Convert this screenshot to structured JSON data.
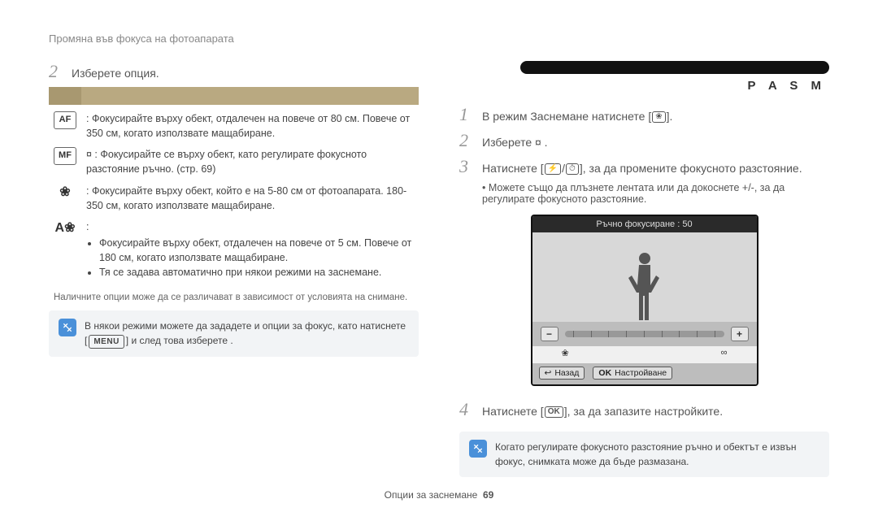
{
  "header": {
    "title": "Промяна във фокуса на фотоапарата"
  },
  "left": {
    "step2_num": "2",
    "step2_text": "Изберете опция.",
    "options": [
      {
        "icon_label": "AF",
        "name": "autofocus-icon",
        "text": ": Фокусирайте върху обект, отдалечен на повече от 80 см. Повече от 350 см, когато използвате мащабиране."
      },
      {
        "icon_label": "MF",
        "name": "manual-focus-icon",
        "text": "¤                          : Фокусирайте се върху обект, като регулирате фокусното разстояние ръчно. (стр. 69)"
      },
      {
        "icon_label": "❀",
        "name": "macro-icon",
        "text": ": Фокусирайте върху обект, който е на 5-80 см от фотоапарата. 180-350 см, когато използвате мащабиране."
      },
      {
        "icon_label": "A❀",
        "name": "auto-macro-icon",
        "text": ":",
        "bullets": [
          "Фокусирайте върху обект, отдалечен на повече от 5 см. Повече от 180 см, когато използвате мащабиране.",
          "Тя се задава автоматично при някои режими на заснемане."
        ]
      }
    ],
    "footnote": "Наличните опции може да се различават в зависимост от условията на снимане.",
    "infobox": {
      "line1": "В някои режими можете да зададете и опции за фокус, като натиснете",
      "menu_label": "MENU",
      "line2": " и след това изберете         ."
    }
  },
  "right": {
    "pasm": "P A S M",
    "step1_num": "1",
    "step1_text_a": "В режим Заснемане натиснете [",
    "step1_text_b": "].",
    "step2_num": "2",
    "step2_text": "Изберете ¤                          .",
    "step3_num": "3",
    "step3_text_a": "Натиснете [",
    "step3_text_b": "], за да промените фокусното разстояние.",
    "step3_sub": "Можете също да плъзнете лентата или да докоснете +/-, за да регулирате фокусното разстояние.",
    "lcd": {
      "title": "Ръчно фокусиране : 50",
      "minus": "−",
      "plus": "+",
      "macro_sym": "❀",
      "inf_sym": "∞",
      "back_sym": "↩",
      "back_label": "Назад",
      "ok_sym": "OK",
      "ok_label": "Настройване"
    },
    "step4_num": "4",
    "step4_text_a": "Натиснете [",
    "ok_badge": "OK",
    "step4_text_b": "], за да запазите настройките.",
    "infobox": "Когато регулирате фокусното разстояние ръчно и обектът е извън фокус, снимката може да бъде размазана."
  },
  "footer": {
    "section": "Опции за заснемане",
    "page": "69"
  }
}
